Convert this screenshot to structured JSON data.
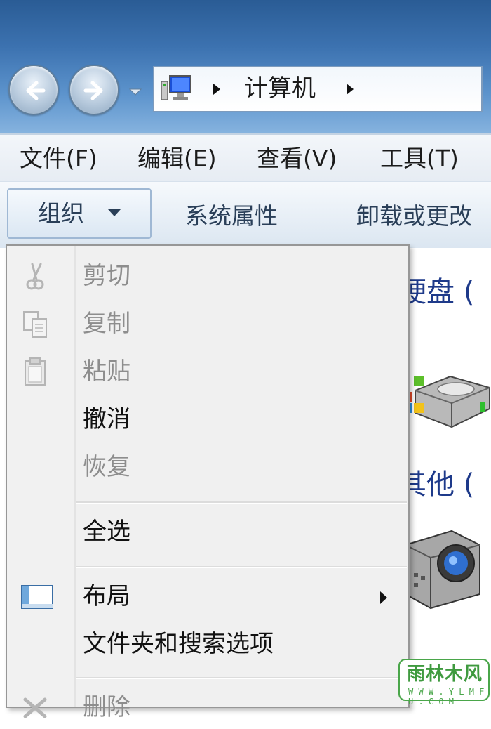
{
  "address_bar": {
    "breadcrumb": "计算机"
  },
  "menubar": {
    "items": [
      "文件(F)",
      "编辑(E)",
      "查看(V)",
      "工具(T)"
    ]
  },
  "command_bar": {
    "organize": "组织",
    "items": [
      "系统属性",
      "卸载或更改"
    ]
  },
  "background_content": {
    "headings": [
      "硬盘 (",
      "其他 ("
    ]
  },
  "organize_menu": {
    "items": [
      {
        "label": "剪切",
        "enabled": false,
        "icon": "scissors-icon"
      },
      {
        "label": "复制",
        "enabled": false,
        "icon": "copy-icon"
      },
      {
        "label": "粘贴",
        "enabled": false,
        "icon": "paste-icon"
      },
      {
        "label": "撤消",
        "enabled": true,
        "icon": ""
      },
      {
        "label": "恢复",
        "enabled": false,
        "icon": ""
      },
      {
        "label": "全选",
        "enabled": true,
        "icon": ""
      },
      {
        "label": "布局",
        "enabled": true,
        "icon": "layout-icon",
        "submenu": true
      },
      {
        "label": "文件夹和搜索选项",
        "enabled": true,
        "icon": ""
      },
      {
        "label": "删除",
        "enabled": false,
        "icon": "delete-icon"
      }
    ]
  },
  "watermark": {
    "text": "雨林木风",
    "url": "W W W . Y L M F U . C O M"
  },
  "colors": {
    "titlebar": "#3c72b0",
    "disabled_text": "#8d8d8d",
    "heading_blue": "#1e3a8a",
    "watermark_green": "#4aa64a"
  }
}
